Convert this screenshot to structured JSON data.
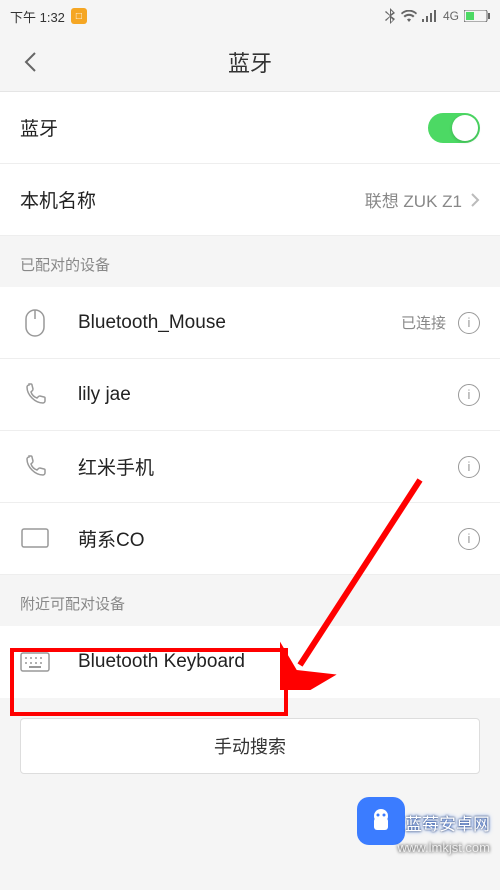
{
  "status_bar": {
    "time": "下午 1:32",
    "network": "4G",
    "icons": {
      "sync": "□",
      "bluetooth": "bt",
      "wifi": "wifi",
      "signal": "signal",
      "battery": "battery"
    }
  },
  "header": {
    "title": "蓝牙"
  },
  "settings": {
    "bluetooth_label": "蓝牙",
    "bluetooth_on": true,
    "device_name_label": "本机名称",
    "device_name_value": "联想 ZUK Z1"
  },
  "sections": {
    "paired_header": "已配对的设备",
    "nearby_header": "附近可配对设备"
  },
  "paired_devices": [
    {
      "name": "Bluetooth_Mouse",
      "icon": "mouse",
      "status": "已连接"
    },
    {
      "name": "lily jae",
      "icon": "phone",
      "status": ""
    },
    {
      "name": "红米手机",
      "icon": "phone",
      "status": ""
    },
    {
      "name": "萌系CO",
      "icon": "display",
      "status": ""
    }
  ],
  "nearby_devices": [
    {
      "name": "Bluetooth Keyboard",
      "icon": "keyboard"
    }
  ],
  "search_button": "手动搜索",
  "watermark": {
    "name": "蓝莓安卓网",
    "url": "www.lmkjst.com"
  },
  "colors": {
    "toggle_on": "#4cd964",
    "highlight": "#ff0000",
    "arrow": "#ff0000",
    "brand": "#3b7cff"
  }
}
